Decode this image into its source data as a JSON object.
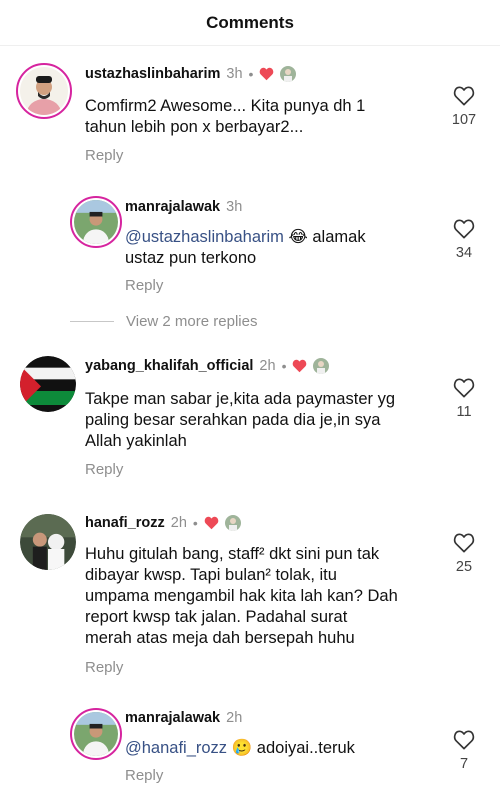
{
  "header": {
    "title": "Comments"
  },
  "comments": [
    {
      "username": "ustazhaslinbaharim",
      "time": "3h",
      "dot": "•",
      "text": "Comfirm2 Awesome... Kita punya dh 1 tahun lebih pon x berbayar2...",
      "line1": "Comfirm2 Awesome... Kita punya dh 1",
      "line2": "tahun lebih pon x berbayar2...",
      "reply": "Reply",
      "likes": "107"
    },
    {
      "username": "manrajalawak",
      "time": "3h",
      "mention": "@ustazhaslinbaharim",
      "emoji": "😂",
      "line1_rest": " alamak",
      "line2": "ustaz pun terkono",
      "reply": "Reply",
      "likes": "34"
    },
    {
      "username": "yabang_khalifah_official",
      "time": "2h",
      "dot": "•",
      "line1": "Takpe man sabar je,kita ada paymaster yg",
      "line2": "paling besar serahkan pada dia je,in sya",
      "line3": "Allah yakinlah",
      "reply": "Reply",
      "likes": "11"
    },
    {
      "username": "hanafi_rozz",
      "time": "2h",
      "dot": "•",
      "line1": "Huhu gitulah bang, staff² dkt sini pun tak",
      "line2": "dibayar kwsp. Tapi bulan² tolak, itu",
      "line3": "umpama mengambil hak kita lah kan? Dah",
      "line4": "report kwsp tak jalan.  Padahal surat",
      "line5": "merah atas meja dah bersepah huhu",
      "reply": "Reply",
      "likes": "25"
    },
    {
      "username": "manrajalawak",
      "time": "2h",
      "mention": "@hanafi_rozz",
      "emoji": "🥲",
      "line1_rest": " adoiyai..teruk",
      "reply": "Reply",
      "likes": "7"
    }
  ],
  "view_more": "View 2 more replies",
  "colors": {
    "heart_red": "#ed4956",
    "mention": "#385185",
    "muted": "#8e8e8e",
    "story_ring": "#d6249f"
  }
}
